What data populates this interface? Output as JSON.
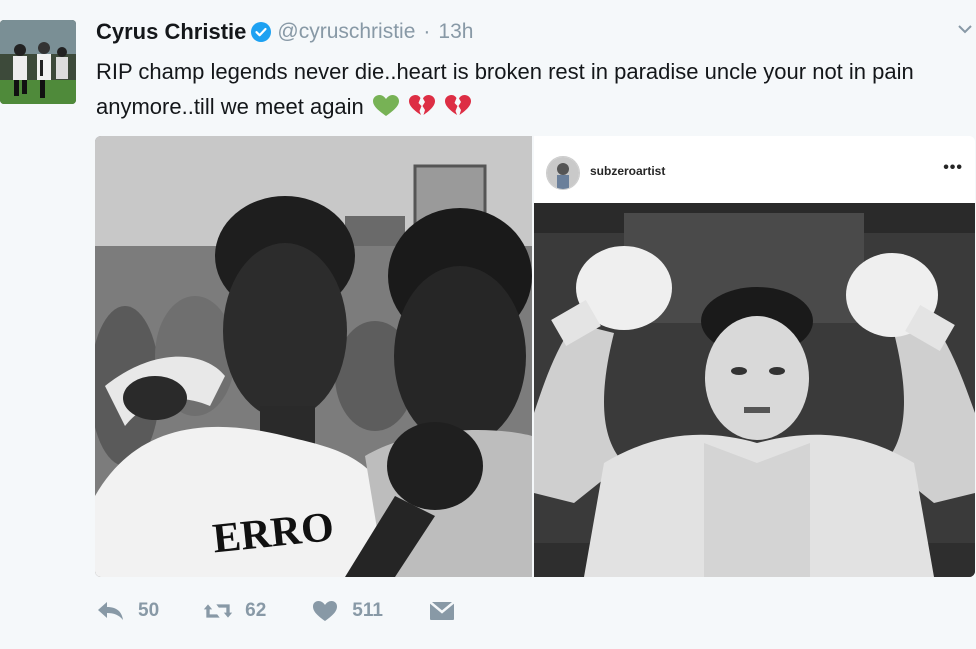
{
  "tweet": {
    "author_name": "Cyrus Christie",
    "handle": "@cyruschristie",
    "separator": "·",
    "time": "13h",
    "text": "RIP champ legends never die..heart is broken rest in paradise uncle your not in pain anymore..till we meet again",
    "emojis": [
      "green-heart",
      "broken-heart",
      "broken-heart"
    ]
  },
  "media": {
    "left_photo": {
      "shirt_text": "ERRO"
    },
    "embedded_post": {
      "username": "subzeroartist",
      "menu": "•••"
    }
  },
  "actions": {
    "reply_count": "50",
    "retweet_count": "62",
    "like_count": "511"
  },
  "colors": {
    "background": "#f5f8fa",
    "verified": "#1da1f2",
    "action_gray": "#8899a6",
    "green_heart": "#77b255",
    "broken_heart": "#dd2e44"
  }
}
